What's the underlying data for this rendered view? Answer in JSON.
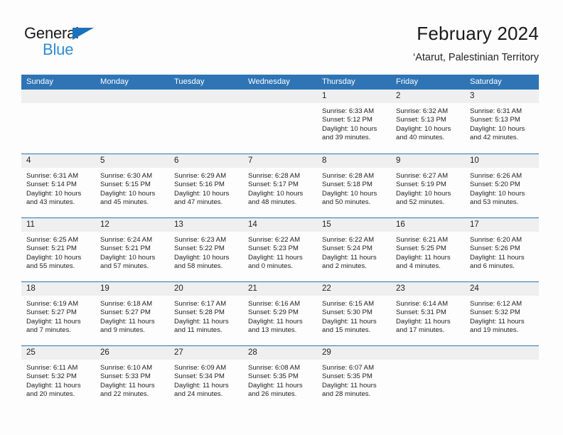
{
  "brand": {
    "name_part1": "General",
    "name_part2": "Blue",
    "triangle_color": "#1b72bb",
    "blue_color": "#2e8bd6"
  },
  "header": {
    "title": "February 2024",
    "subtitle": "‘Atarut, Palestinian Territory"
  },
  "theme": {
    "header_blue": "#2f74b5",
    "daynum_band": "#efefef",
    "page_bg": "#fdfdfd",
    "text": "#1f1f1f"
  },
  "weekdays": [
    "Sunday",
    "Monday",
    "Tuesday",
    "Wednesday",
    "Thursday",
    "Friday",
    "Saturday"
  ],
  "weeks": [
    [
      {
        "day": "",
        "sunrise": "",
        "sunset": "",
        "daylight_line1": "",
        "daylight_line2": ""
      },
      {
        "day": "",
        "sunrise": "",
        "sunset": "",
        "daylight_line1": "",
        "daylight_line2": ""
      },
      {
        "day": "",
        "sunrise": "",
        "sunset": "",
        "daylight_line1": "",
        "daylight_line2": ""
      },
      {
        "day": "",
        "sunrise": "",
        "sunset": "",
        "daylight_line1": "",
        "daylight_line2": ""
      },
      {
        "day": "1",
        "sunrise": "Sunrise: 6:33 AM",
        "sunset": "Sunset: 5:12 PM",
        "daylight_line1": "Daylight: 10 hours",
        "daylight_line2": "and 39 minutes."
      },
      {
        "day": "2",
        "sunrise": "Sunrise: 6:32 AM",
        "sunset": "Sunset: 5:13 PM",
        "daylight_line1": "Daylight: 10 hours",
        "daylight_line2": "and 40 minutes."
      },
      {
        "day": "3",
        "sunrise": "Sunrise: 6:31 AM",
        "sunset": "Sunset: 5:13 PM",
        "daylight_line1": "Daylight: 10 hours",
        "daylight_line2": "and 42 minutes."
      }
    ],
    [
      {
        "day": "4",
        "sunrise": "Sunrise: 6:31 AM",
        "sunset": "Sunset: 5:14 PM",
        "daylight_line1": "Daylight: 10 hours",
        "daylight_line2": "and 43 minutes."
      },
      {
        "day": "5",
        "sunrise": "Sunrise: 6:30 AM",
        "sunset": "Sunset: 5:15 PM",
        "daylight_line1": "Daylight: 10 hours",
        "daylight_line2": "and 45 minutes."
      },
      {
        "day": "6",
        "sunrise": "Sunrise: 6:29 AM",
        "sunset": "Sunset: 5:16 PM",
        "daylight_line1": "Daylight: 10 hours",
        "daylight_line2": "and 47 minutes."
      },
      {
        "day": "7",
        "sunrise": "Sunrise: 6:28 AM",
        "sunset": "Sunset: 5:17 PM",
        "daylight_line1": "Daylight: 10 hours",
        "daylight_line2": "and 48 minutes."
      },
      {
        "day": "8",
        "sunrise": "Sunrise: 6:28 AM",
        "sunset": "Sunset: 5:18 PM",
        "daylight_line1": "Daylight: 10 hours",
        "daylight_line2": "and 50 minutes."
      },
      {
        "day": "9",
        "sunrise": "Sunrise: 6:27 AM",
        "sunset": "Sunset: 5:19 PM",
        "daylight_line1": "Daylight: 10 hours",
        "daylight_line2": "and 52 minutes."
      },
      {
        "day": "10",
        "sunrise": "Sunrise: 6:26 AM",
        "sunset": "Sunset: 5:20 PM",
        "daylight_line1": "Daylight: 10 hours",
        "daylight_line2": "and 53 minutes."
      }
    ],
    [
      {
        "day": "11",
        "sunrise": "Sunrise: 6:25 AM",
        "sunset": "Sunset: 5:21 PM",
        "daylight_line1": "Daylight: 10 hours",
        "daylight_line2": "and 55 minutes."
      },
      {
        "day": "12",
        "sunrise": "Sunrise: 6:24 AM",
        "sunset": "Sunset: 5:21 PM",
        "daylight_line1": "Daylight: 10 hours",
        "daylight_line2": "and 57 minutes."
      },
      {
        "day": "13",
        "sunrise": "Sunrise: 6:23 AM",
        "sunset": "Sunset: 5:22 PM",
        "daylight_line1": "Daylight: 10 hours",
        "daylight_line2": "and 58 minutes."
      },
      {
        "day": "14",
        "sunrise": "Sunrise: 6:22 AM",
        "sunset": "Sunset: 5:23 PM",
        "daylight_line1": "Daylight: 11 hours",
        "daylight_line2": "and 0 minutes."
      },
      {
        "day": "15",
        "sunrise": "Sunrise: 6:22 AM",
        "sunset": "Sunset: 5:24 PM",
        "daylight_line1": "Daylight: 11 hours",
        "daylight_line2": "and 2 minutes."
      },
      {
        "day": "16",
        "sunrise": "Sunrise: 6:21 AM",
        "sunset": "Sunset: 5:25 PM",
        "daylight_line1": "Daylight: 11 hours",
        "daylight_line2": "and 4 minutes."
      },
      {
        "day": "17",
        "sunrise": "Sunrise: 6:20 AM",
        "sunset": "Sunset: 5:26 PM",
        "daylight_line1": "Daylight: 11 hours",
        "daylight_line2": "and 6 minutes."
      }
    ],
    [
      {
        "day": "18",
        "sunrise": "Sunrise: 6:19 AM",
        "sunset": "Sunset: 5:27 PM",
        "daylight_line1": "Daylight: 11 hours",
        "daylight_line2": "and 7 minutes."
      },
      {
        "day": "19",
        "sunrise": "Sunrise: 6:18 AM",
        "sunset": "Sunset: 5:27 PM",
        "daylight_line1": "Daylight: 11 hours",
        "daylight_line2": "and 9 minutes."
      },
      {
        "day": "20",
        "sunrise": "Sunrise: 6:17 AM",
        "sunset": "Sunset: 5:28 PM",
        "daylight_line1": "Daylight: 11 hours",
        "daylight_line2": "and 11 minutes."
      },
      {
        "day": "21",
        "sunrise": "Sunrise: 6:16 AM",
        "sunset": "Sunset: 5:29 PM",
        "daylight_line1": "Daylight: 11 hours",
        "daylight_line2": "and 13 minutes."
      },
      {
        "day": "22",
        "sunrise": "Sunrise: 6:15 AM",
        "sunset": "Sunset: 5:30 PM",
        "daylight_line1": "Daylight: 11 hours",
        "daylight_line2": "and 15 minutes."
      },
      {
        "day": "23",
        "sunrise": "Sunrise: 6:14 AM",
        "sunset": "Sunset: 5:31 PM",
        "daylight_line1": "Daylight: 11 hours",
        "daylight_line2": "and 17 minutes."
      },
      {
        "day": "24",
        "sunrise": "Sunrise: 6:12 AM",
        "sunset": "Sunset: 5:32 PM",
        "daylight_line1": "Daylight: 11 hours",
        "daylight_line2": "and 19 minutes."
      }
    ],
    [
      {
        "day": "25",
        "sunrise": "Sunrise: 6:11 AM",
        "sunset": "Sunset: 5:32 PM",
        "daylight_line1": "Daylight: 11 hours",
        "daylight_line2": "and 20 minutes."
      },
      {
        "day": "26",
        "sunrise": "Sunrise: 6:10 AM",
        "sunset": "Sunset: 5:33 PM",
        "daylight_line1": "Daylight: 11 hours",
        "daylight_line2": "and 22 minutes."
      },
      {
        "day": "27",
        "sunrise": "Sunrise: 6:09 AM",
        "sunset": "Sunset: 5:34 PM",
        "daylight_line1": "Daylight: 11 hours",
        "daylight_line2": "and 24 minutes."
      },
      {
        "day": "28",
        "sunrise": "Sunrise: 6:08 AM",
        "sunset": "Sunset: 5:35 PM",
        "daylight_line1": "Daylight: 11 hours",
        "daylight_line2": "and 26 minutes."
      },
      {
        "day": "29",
        "sunrise": "Sunrise: 6:07 AM",
        "sunset": "Sunset: 5:35 PM",
        "daylight_line1": "Daylight: 11 hours",
        "daylight_line2": "and 28 minutes."
      },
      {
        "day": "",
        "sunrise": "",
        "sunset": "",
        "daylight_line1": "",
        "daylight_line2": ""
      },
      {
        "day": "",
        "sunrise": "",
        "sunset": "",
        "daylight_line1": "",
        "daylight_line2": ""
      }
    ]
  ]
}
